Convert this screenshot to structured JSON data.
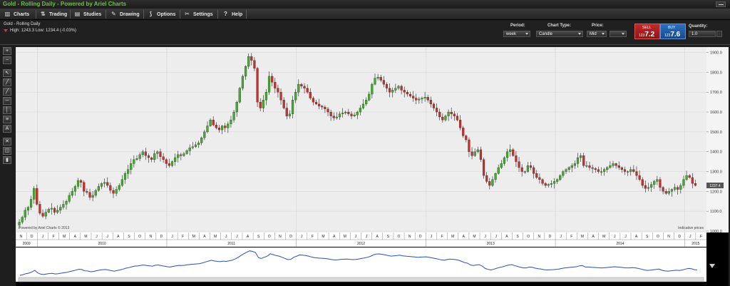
{
  "window": {
    "title": "Gold - Rolling Daily - Powered by Ariel Charts"
  },
  "menu": {
    "items": [
      {
        "label": "Charts",
        "icon": "bar-chart-icon"
      },
      {
        "label": "Trading",
        "icon": "trading-icon"
      },
      {
        "label": "Studies",
        "icon": "studies-icon"
      },
      {
        "label": "Drawing",
        "icon": "pencil-icon"
      },
      {
        "label": "Options",
        "icon": "options-icon"
      },
      {
        "label": "Settings",
        "icon": "wrench-icon"
      },
      {
        "label": "Help",
        "icon": "help-icon"
      }
    ]
  },
  "header": {
    "instrument": "Gold - Rolling Daily",
    "hilo": "High: 1243.3 Low: 1234.4 (-0.03%)",
    "period_label": "Period:",
    "period_value": "week",
    "chart_type_label": "Chart Type:",
    "chart_type_value": "Candle",
    "price_label": "Price:",
    "price_value": "Mid",
    "sell_label": "SELL",
    "sell_price_prefix": "123",
    "sell_price_big": "7.2",
    "buy_label": "BUY",
    "buy_price_prefix": "123",
    "buy_price_big": "7.6",
    "quantity_label": "Quantity:",
    "quantity_value": "1.0"
  },
  "chart": {
    "watermark": "Powered by Ariel Charts © 2013",
    "indicative": "Indicative prices",
    "last_price_tag": "1237.4",
    "months": [
      "N",
      "D",
      "J",
      "F",
      "M",
      "A",
      "M",
      "J",
      "J",
      "A",
      "S",
      "O",
      "N",
      "D",
      "J",
      "F",
      "M",
      "A",
      "M",
      "J",
      "J",
      "A",
      "S",
      "O",
      "N",
      "D",
      "J",
      "F",
      "M",
      "A",
      "M",
      "J",
      "J",
      "A",
      "S",
      "O",
      "N",
      "D",
      "J",
      "F",
      "M",
      "A",
      "M",
      "J",
      "J",
      "A",
      "S",
      "O",
      "N",
      "D",
      "J",
      "F",
      "M",
      "A",
      "M",
      "J",
      "J",
      "A",
      "S",
      "O",
      "N",
      "D",
      "J",
      "F"
    ],
    "years": [
      {
        "label": "2009",
        "from": 0,
        "to": 2
      },
      {
        "label": "2010",
        "from": 2,
        "to": 14
      },
      {
        "label": "2011",
        "from": 14,
        "to": 26
      },
      {
        "label": "2012",
        "from": 26,
        "to": 38
      },
      {
        "label": "2013",
        "from": 38,
        "to": 50
      },
      {
        "label": "2014",
        "from": 50,
        "to": 62
      },
      {
        "label": "2015",
        "from": 62,
        "to": 64
      }
    ]
  },
  "chart_data": {
    "type": "candlestick",
    "ylim": [
      1000,
      1920
    ],
    "yticks": [
      "1000.0",
      "1100.0",
      "1200.0",
      "1300.0",
      "1400.0",
      "1500.0",
      "1600.0",
      "1700.0",
      "1800.0",
      "1900.0"
    ],
    "x_unit": "weeks from start (Oct 2009)",
    "closes": [
      1045,
      1070,
      1105,
      1120,
      1160,
      1215,
      1135,
      1090,
      1075,
      1095,
      1110,
      1115,
      1095,
      1105,
      1120,
      1135,
      1150,
      1180,
      1200,
      1225,
      1255,
      1245,
      1200,
      1195,
      1170,
      1180,
      1205,
      1225,
      1240,
      1245,
      1230,
      1205,
      1190,
      1210,
      1230,
      1260,
      1290,
      1310,
      1340,
      1360,
      1365,
      1385,
      1400,
      1380,
      1370,
      1360,
      1390,
      1400,
      1375,
      1360,
      1340,
      1330,
      1350,
      1370,
      1385,
      1380,
      1390,
      1405,
      1420,
      1425,
      1435,
      1445,
      1470,
      1500,
      1530,
      1560,
      1535,
      1520,
      1510,
      1530,
      1520,
      1540,
      1560,
      1600,
      1650,
      1720,
      1780,
      1830,
      1880,
      1860,
      1820,
      1650,
      1620,
      1660,
      1700,
      1780,
      1750,
      1720,
      1700,
      1660,
      1620,
      1580,
      1590,
      1660,
      1700,
      1740,
      1730,
      1720,
      1700,
      1670,
      1650,
      1640,
      1630,
      1625,
      1615,
      1600,
      1580,
      1570,
      1575,
      1590,
      1595,
      1600,
      1590,
      1580,
      1585,
      1600,
      1620,
      1640,
      1660,
      1690,
      1740,
      1770,
      1775,
      1760,
      1740,
      1720,
      1700,
      1710,
      1720,
      1730,
      1710,
      1700,
      1690,
      1680,
      1670,
      1660,
      1665,
      1670,
      1675,
      1660,
      1640,
      1620,
      1600,
      1575,
      1560,
      1580,
      1600,
      1590,
      1580,
      1560,
      1520,
      1480,
      1460,
      1400,
      1380,
      1400,
      1410,
      1360,
      1280,
      1250,
      1230,
      1260,
      1290,
      1320,
      1340,
      1370,
      1400,
      1410,
      1380,
      1350,
      1320,
      1300,
      1300,
      1330,
      1320,
      1290,
      1270,
      1260,
      1240,
      1230,
      1235,
      1240,
      1250,
      1260,
      1280,
      1300,
      1310,
      1320,
      1330,
      1340,
      1370,
      1380,
      1330,
      1330,
      1320,
      1315,
      1310,
      1300,
      1300,
      1310,
      1320,
      1330,
      1340,
      1330,
      1320,
      1310,
      1300,
      1300,
      1310,
      1300,
      1280,
      1260,
      1230,
      1215,
      1220,
      1235,
      1250,
      1260,
      1220,
      1200,
      1190,
      1200,
      1210,
      1220,
      1210,
      1230,
      1260,
      1280,
      1270,
      1240,
      1230
    ]
  },
  "overview": {
    "note": "Overview navigator line (same series, compressed)"
  }
}
